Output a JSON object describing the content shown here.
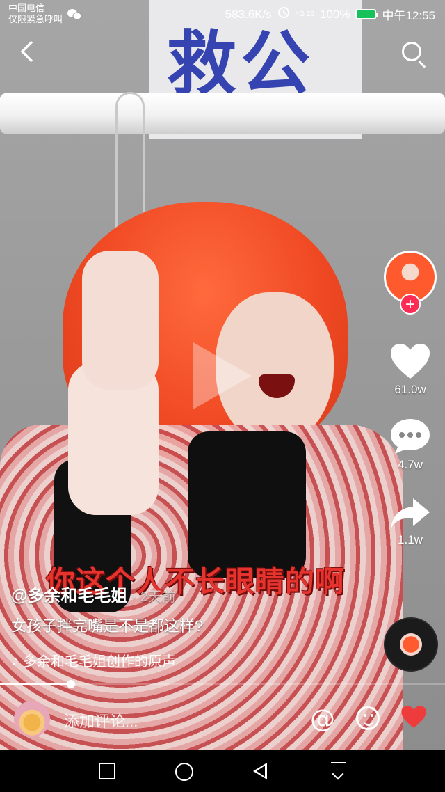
{
  "status_bar": {
    "carrier_line1": "中国电信",
    "carrier_line2": "仅限紧急呼叫",
    "speed": "583.6K/s",
    "network": "4G 26",
    "battery": "100%",
    "time": "中午12:55",
    "battery_color": "#18c25a"
  },
  "video": {
    "sign_text": "救公",
    "subtitle": "你这个人不长眼睛的啊"
  },
  "actions": {
    "likes": "61.0w",
    "comments": "4.7w",
    "shares": "1.1w",
    "follow_symbol": "+",
    "accent": "#fd2c55"
  },
  "post": {
    "username": "@多余和毛毛姐",
    "time_ago": "· 2天前",
    "description": "女孩子拌完嘴是不是都这样?",
    "music": "多余和毛毛姐创作的原声",
    "music_icon": "♪",
    "progress_fraction": 0.16
  },
  "comment_bar": {
    "placeholder": "添加评论...",
    "at_symbol": "@",
    "like_color": "#ee3b3b"
  },
  "icons": {
    "back": "chevron-left-icon",
    "search": "search-icon",
    "like": "heart-icon",
    "comment": "comment-bubble-icon",
    "share": "share-arrow-icon"
  }
}
